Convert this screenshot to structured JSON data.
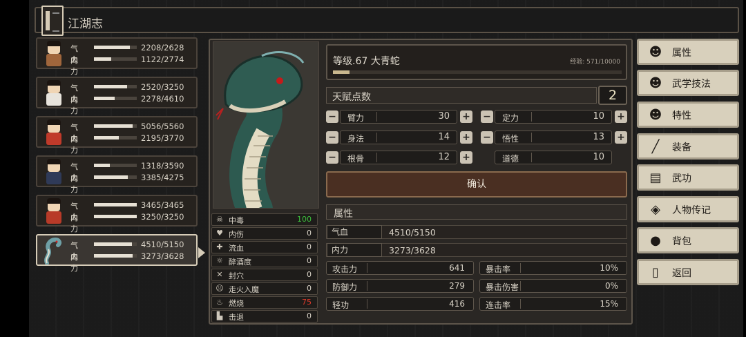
{
  "header": {
    "title": "江湖志"
  },
  "roster": [
    {
      "hp_label": "气血",
      "hp_value": "2208/2628",
      "hp_fill": 0.84,
      "mp_label": "内力",
      "mp_value": "1122/2774",
      "mp_fill": 0.4
    },
    {
      "hp_label": "气血",
      "hp_value": "2520/3250",
      "hp_fill": 0.78,
      "mp_label": "内力",
      "mp_value": "2278/4610",
      "mp_fill": 0.49
    },
    {
      "hp_label": "气血",
      "hp_value": "5056/5560",
      "hp_fill": 0.91,
      "mp_label": "内力",
      "mp_value": "2195/3770",
      "mp_fill": 0.58
    },
    {
      "hp_label": "气血",
      "hp_value": "1318/3590",
      "hp_fill": 0.37,
      "mp_label": "内力",
      "mp_value": "3385/4275",
      "mp_fill": 0.79
    },
    {
      "hp_label": "气血",
      "hp_value": "3465/3465",
      "hp_fill": 1.0,
      "mp_label": "内力",
      "mp_value": "3250/3250",
      "mp_fill": 1.0
    },
    {
      "hp_label": "气血",
      "hp_value": "4510/5150",
      "hp_fill": 0.88,
      "mp_label": "内力",
      "mp_value": "3273/3628",
      "mp_fill": 0.9
    }
  ],
  "status": [
    {
      "name": "中毒",
      "value": "100",
      "color": "#3bbf3b"
    },
    {
      "name": "内伤",
      "value": "0",
      "color": "#d8d2c6"
    },
    {
      "name": "流血",
      "value": "0",
      "color": "#d8d2c6"
    },
    {
      "name": "醉酒度",
      "value": "0",
      "color": "#d8d2c6"
    },
    {
      "name": "封穴",
      "value": "0",
      "color": "#d8d2c6"
    },
    {
      "name": "走火入魔",
      "value": "0",
      "color": "#d8d2c6"
    },
    {
      "name": "燃烧",
      "value": "75",
      "color": "#e03a2a"
    },
    {
      "name": "击退",
      "value": "0",
      "color": "#d8d2c6"
    }
  ],
  "level": {
    "text": "等级.67  大青蛇",
    "exp_text": "经验: 571/10000",
    "exp_fill": 0.057
  },
  "talent": {
    "label": "天赋点数",
    "value": "2"
  },
  "attributes": [
    {
      "name": "臂力",
      "value": "30"
    },
    {
      "name": "定力",
      "value": "10"
    },
    {
      "name": "身法",
      "value": "14"
    },
    {
      "name": "悟性",
      "value": "13"
    },
    {
      "name": "根骨",
      "value": "12"
    },
    {
      "name": "道德",
      "value": "10"
    }
  ],
  "confirm_label": "确认",
  "props": {
    "section_title": "属性",
    "hp_label": "气血",
    "hp_value": "4510/5150",
    "mp_label": "内力",
    "mp_value": "3273/3628",
    "attack_label": "攻击力",
    "attack_value": "641",
    "crit_rate_label": "暴击率",
    "crit_rate_value": "10%",
    "defense_label": "防御力",
    "defense_value": "279",
    "crit_dmg_label": "暴击伤害",
    "crit_dmg_value": "0%",
    "agility_label": "轻功",
    "agility_value": "416",
    "combo_label": "连击率",
    "combo_value": "15%"
  },
  "menu": [
    {
      "label": "属性",
      "icon": "person-icon"
    },
    {
      "label": "武学技法",
      "icon": "martial-skills-icon"
    },
    {
      "label": "特性",
      "icon": "traits-icon"
    },
    {
      "label": "装备",
      "icon": "sword-icon"
    },
    {
      "label": "武功",
      "icon": "manual-icon"
    },
    {
      "label": "人物传记",
      "icon": "biography-icon"
    },
    {
      "label": "背包",
      "icon": "bag-icon"
    },
    {
      "label": "返回",
      "icon": "door-icon"
    }
  ]
}
